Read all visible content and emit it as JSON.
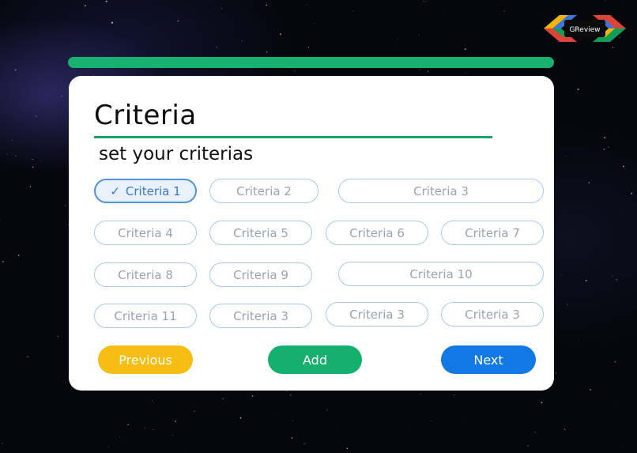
{
  "brand": {
    "logo_text": "GReview"
  },
  "progress": {
    "fraction": 1.0,
    "color": "#17b26f"
  },
  "card": {
    "title": "Criteria",
    "subtitle": "set your criterias"
  },
  "chips": [
    {
      "label": "Criteria 1",
      "selected": true
    },
    {
      "label": "Criteria 2",
      "selected": false
    },
    {
      "label": "Criteria 3",
      "selected": false
    },
    {
      "label": "Criteria 4",
      "selected": false
    },
    {
      "label": "Criteria 5",
      "selected": false
    },
    {
      "label": "Criteria 6",
      "selected": false
    },
    {
      "label": "Criteria 7",
      "selected": false
    },
    {
      "label": "Criteria 8",
      "selected": false
    },
    {
      "label": "Criteria 9",
      "selected": false
    },
    {
      "label": "Criteria 10",
      "selected": false
    },
    {
      "label": "Criteria 11",
      "selected": false
    },
    {
      "label": "Criteria 3",
      "selected": false
    },
    {
      "label": "Criteria 3",
      "selected": false
    },
    {
      "label": "Criteria 3",
      "selected": false
    }
  ],
  "buttons": {
    "previous": "Previous",
    "add": "Add",
    "next": "Next"
  },
  "colors": {
    "previous": "#f7bd12",
    "add": "#16b06e",
    "next": "#1279e4",
    "selected_chip": "#4f92de"
  },
  "icons": {
    "selected_check": "checkmark-icon"
  }
}
